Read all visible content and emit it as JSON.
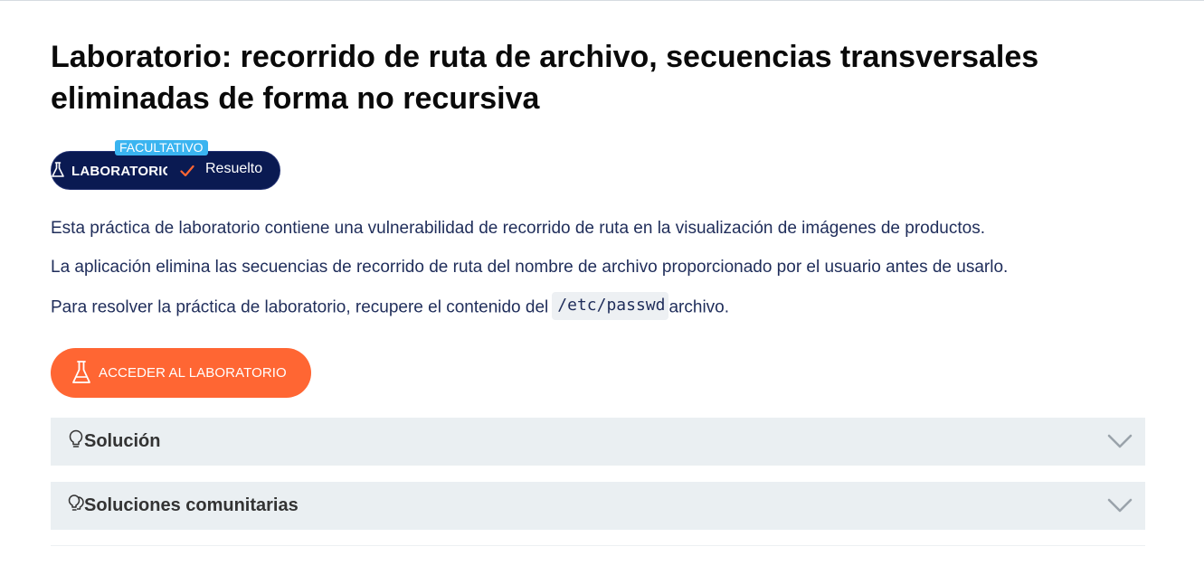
{
  "page": {
    "title": "Laboratorio: recorrido de ruta de archivo, secuencias transversales eliminadas de forma no recursiva"
  },
  "badge": {
    "optional_tag": "FACULTATIVO",
    "level_label": "LABORATORIO",
    "status_label": "Resuelto",
    "icons": [
      "flask-icon",
      "check-icon"
    ]
  },
  "description": {
    "line1": "Esta práctica de laboratorio contiene una vulnerabilidad de recorrido de ruta en la visualización de imágenes de productos.",
    "line2": "La aplicación elimina las secuencias de recorrido de ruta del nombre de archivo proporcionado por el usuario antes de usarlo.",
    "line3_before": "Para resolver la práctica de laboratorio, recupere el contenido del",
    "line3_code": "/etc/passwd",
    "line3_after": "archivo."
  },
  "actions": {
    "access_lab_label": "ACCEDER AL LABORATORIO"
  },
  "accordions": [
    {
      "label": "Solución",
      "icon": "lightbulb-icon",
      "expanded": false
    },
    {
      "label": "Soluciones comunitarias",
      "icon": "community-lightbulb-icon",
      "expanded": false
    }
  ],
  "colors": {
    "title": "#0a0a0a",
    "body_text": "#1f2d5a",
    "badge_bg": "#0a1a52",
    "optional_tag_bg": "#3ab4f0",
    "check": "#ff6633",
    "access_button": "#ff6633",
    "accordion_bg": "#eaeff2"
  }
}
